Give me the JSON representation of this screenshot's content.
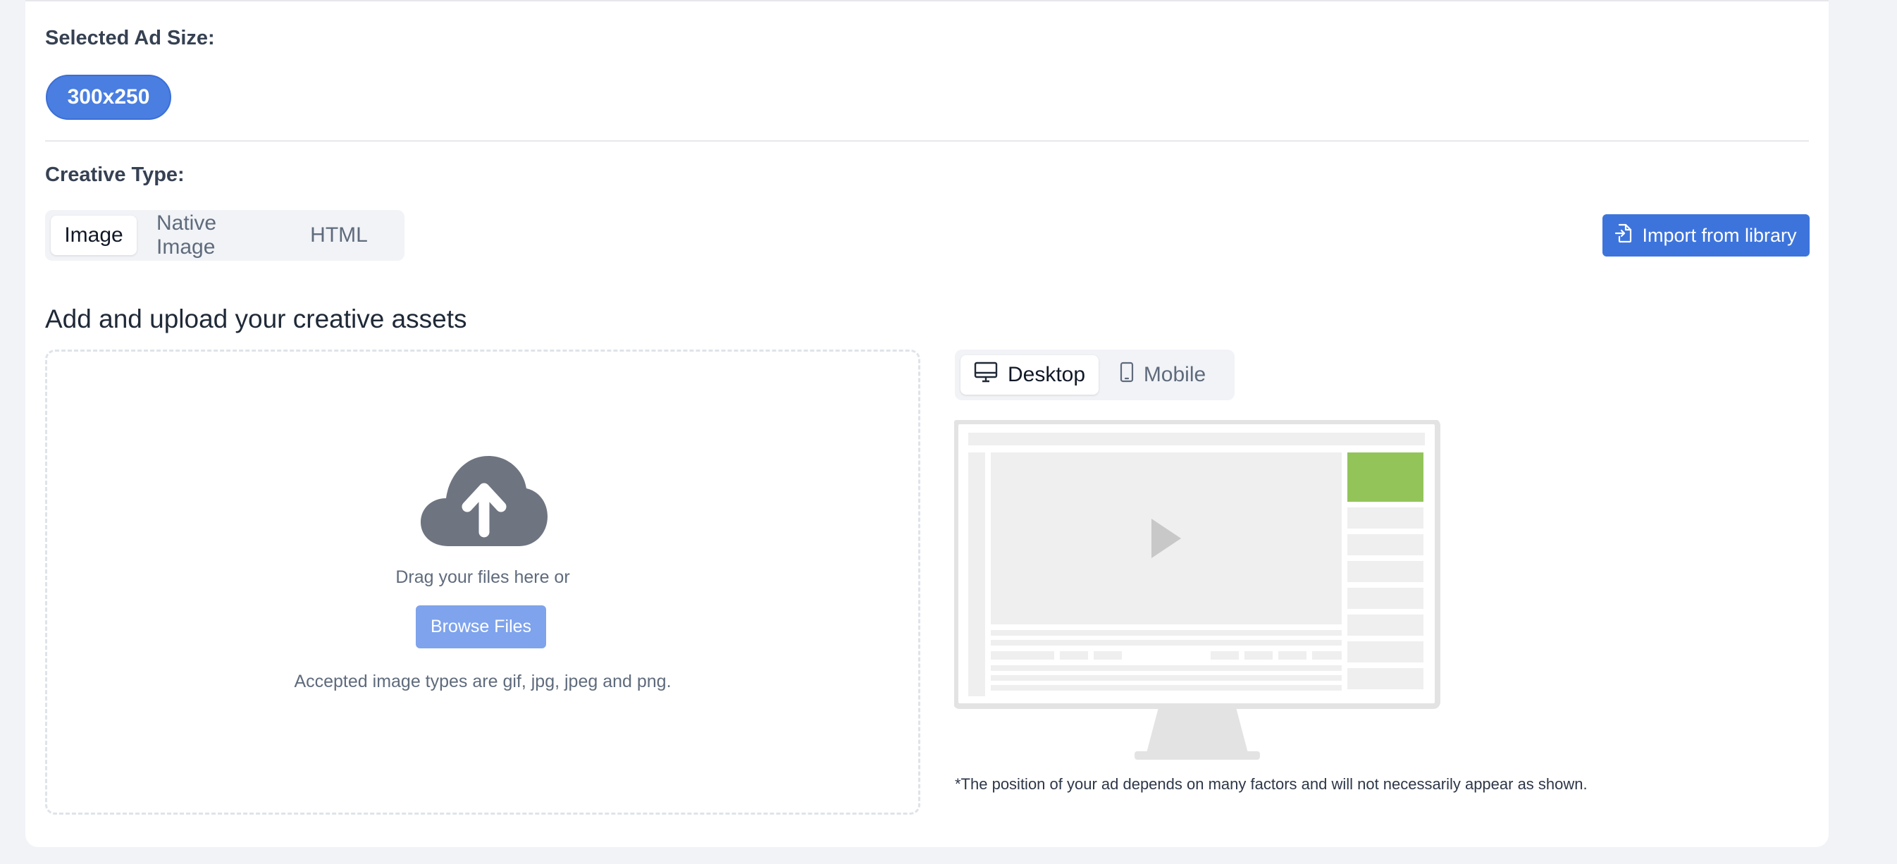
{
  "ad_size": {
    "label": "Selected Ad Size:",
    "selected": "300x250"
  },
  "creative_type": {
    "label": "Creative Type:",
    "tabs": [
      {
        "label": "Image",
        "active": true
      },
      {
        "label": "Native Image",
        "active": false
      },
      {
        "label": "HTML",
        "active": false
      }
    ],
    "import_button": "Import from library"
  },
  "upload": {
    "heading": "Add and upload your creative assets",
    "drag_text": "Drag your files here or",
    "browse_button": "Browse Files",
    "accepted_text": "Accepted image types are gif, jpg, jpeg and png."
  },
  "preview": {
    "devices": [
      {
        "label": "Desktop",
        "icon": "desktop-icon",
        "active": true
      },
      {
        "label": "Mobile",
        "icon": "mobile-icon",
        "active": false
      }
    ],
    "note": "*The position of your ad depends on many factors and will not necessarily appear as shown."
  },
  "colors": {
    "primary": "#3d74dc",
    "pill": "#4a7ee0",
    "browse": "#7fa3ec",
    "ad_slot": "#93c45a"
  }
}
